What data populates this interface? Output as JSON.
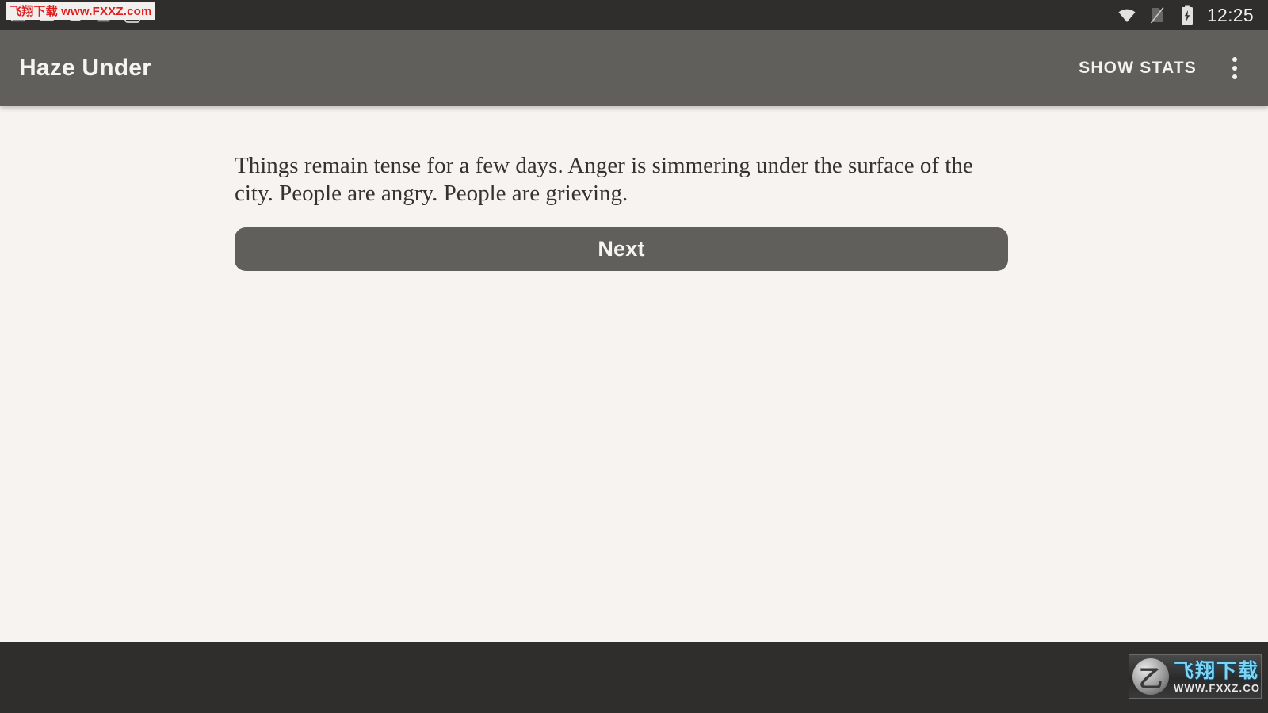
{
  "status_bar": {
    "icons": [
      "browser-window-icon",
      "image-icon",
      "download-arrow-icon",
      "download-tray-icon",
      "shopping-bag-icon"
    ],
    "right_icons": [
      "wifi-icon",
      "no-sim-icon",
      "battery-charging-icon"
    ],
    "time": "12:25"
  },
  "app_bar": {
    "title": "Haze Under",
    "show_stats_label": "SHOW STATS",
    "overflow_menu": "more-options",
    "background_color": "#615F5C"
  },
  "content": {
    "story_text": "Things remain tense for a few days. Anger is simmering under the surface of the city. People are angry. People are grieving.",
    "next_button_label": "Next",
    "background_color": "#F7F3F0",
    "text_color": "#353230"
  },
  "watermarks": {
    "top_text": "飞翔下载 www.FXXZ.com",
    "bottom_brand": "飞翔下载",
    "bottom_url": "WWW.FXXZ.COM",
    "logo_glyph": "乙"
  }
}
